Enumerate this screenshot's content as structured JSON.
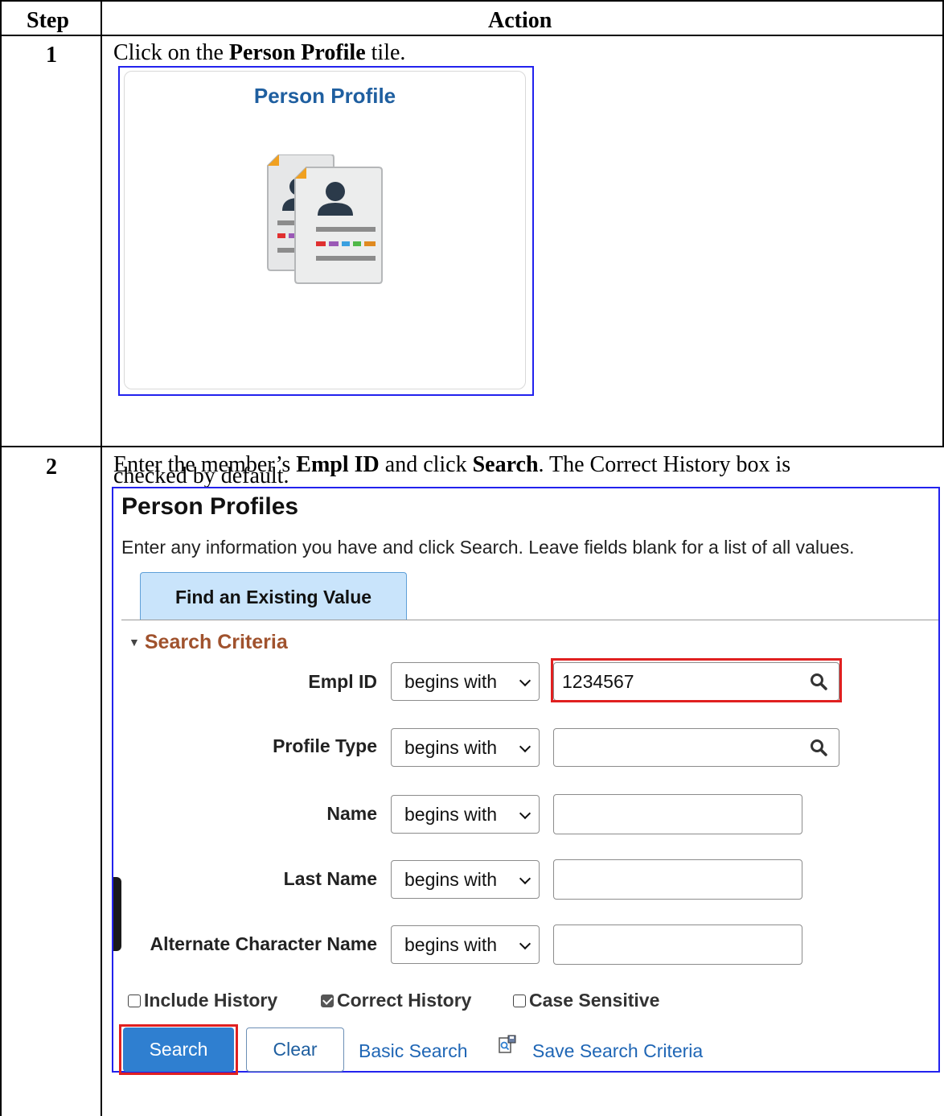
{
  "table": {
    "header_step": "Step",
    "header_action": "Action"
  },
  "steps": [
    {
      "number": "1",
      "pre": "Click on the ",
      "bold": "Person Profile",
      "post": " tile."
    },
    {
      "number": "2",
      "line1_pre": "Enter the member’s ",
      "line1_bold1": "Empl ID",
      "line1_mid": " and click ",
      "line1_bold2": "Search",
      "line1_post": ". The Correct History box is",
      "line2": "checked by default."
    }
  ],
  "tile": {
    "title": "Person Profile",
    "icon": "person-profile-documents-icon"
  },
  "search_page": {
    "title": "Person Profiles",
    "instructions": "Enter any information you have and click Search. Leave fields blank for a list of all values.",
    "tab": "Find an Existing Value",
    "section": "Search Criteria",
    "fields": [
      {
        "label": "Empl ID",
        "operator": "begins with",
        "value": "1234567",
        "lookup": true
      },
      {
        "label": "Profile Type",
        "operator": "begins with",
        "value": "",
        "lookup": true
      },
      {
        "label": "Name",
        "operator": "begins with",
        "value": "",
        "lookup": false
      },
      {
        "label": "Last Name",
        "operator": "begins with",
        "value": "",
        "lookup": false
      },
      {
        "label": "Alternate Character Name",
        "operator": "begins with",
        "value": "",
        "lookup": false
      }
    ],
    "checkboxes": [
      {
        "label": "Include History",
        "checked": false
      },
      {
        "label": "Correct History",
        "checked": true
      },
      {
        "label": "Case Sensitive",
        "checked": false
      }
    ],
    "buttons": {
      "search": "Search",
      "clear": "Clear"
    },
    "links": {
      "basic_search": "Basic Search",
      "save_criteria": "Save Search Criteria"
    }
  },
  "colors": {
    "highlight_red": "#e02020",
    "frame_blue": "#2222ee",
    "link_blue": "#1f66b5",
    "section_brown": "#a0522d",
    "tab_bg": "#c9e4fb"
  }
}
